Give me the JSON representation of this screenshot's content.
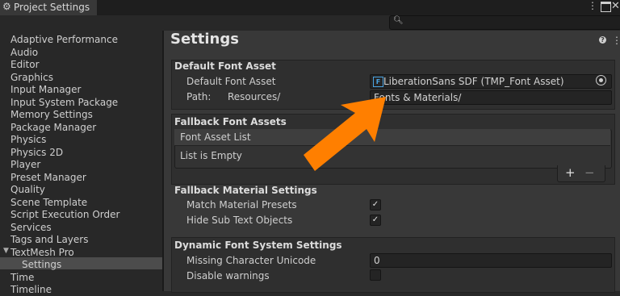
{
  "window": {
    "tab_title": "Project Settings",
    "menu_icon": "kebab-menu-icon",
    "gear_icon": "gear-icon"
  },
  "sidebar": {
    "items": [
      "Adaptive Performance",
      "Audio",
      "Editor",
      "Graphics",
      "Input Manager",
      "Input System Package",
      "Memory Settings",
      "Package Manager",
      "Physics",
      "Physics 2D",
      "Player",
      "Preset Manager",
      "Quality",
      "Scene Template",
      "Script Execution Order",
      "Services",
      "Tags and Layers",
      "TextMesh Pro",
      "Settings",
      "Time",
      "Timeline"
    ],
    "selected": "Settings"
  },
  "main": {
    "title": "Settings",
    "default_font_asset": {
      "header": "Default Font Asset",
      "label": "Default Font Asset",
      "value": "LiberationSans SDF (TMP_Font Asset)",
      "path_label": "Path:",
      "path_prefix": "Resources/",
      "path_value": "Fonts & Materials/"
    },
    "fallback_font_assets": {
      "header": "Fallback Font Assets",
      "list_title": "Font Asset List",
      "empty_text": "List is Empty",
      "add": "+",
      "remove": "−"
    },
    "fallback_material": {
      "header": "Fallback Material Settings",
      "match_presets_label": "Match Material Presets",
      "match_presets_checked": true,
      "hide_sub_label": "Hide Sub Text Objects",
      "hide_sub_checked": true
    },
    "dynamic_font": {
      "header": "Dynamic Font System Settings",
      "missing_label": "Missing Character Unicode",
      "missing_value": "0",
      "disable_warnings_label": "Disable warnings",
      "disable_warnings_checked": false
    }
  },
  "overlay": {
    "arrow_color": "#ff7f00"
  }
}
